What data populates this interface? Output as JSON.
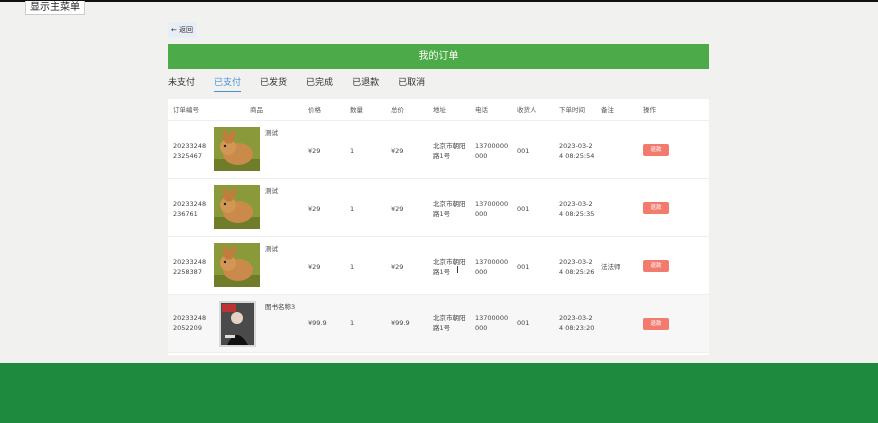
{
  "topbar": {
    "show_menu": "显示主菜单"
  },
  "back_label": "← 返回",
  "page_title": "我的订单",
  "tabs": [
    {
      "label": "未支付",
      "active": false
    },
    {
      "label": "已支付",
      "active": true
    },
    {
      "label": "已发货",
      "active": false
    },
    {
      "label": "已完成",
      "active": false
    },
    {
      "label": "已退款",
      "active": false
    },
    {
      "label": "已取消",
      "active": false
    }
  ],
  "columns": [
    "订单编号",
    "商品",
    "价格",
    "数量",
    "总价",
    "地址",
    "电话",
    "收货人",
    "下单时间",
    "备注",
    "操作"
  ],
  "orders": [
    {
      "id_line1": "20233248",
      "id_line2": "2325467",
      "product": "测试",
      "image": "rabbit",
      "price": "¥29",
      "qty": "1",
      "total": "¥29",
      "addr_line1": "北京市朝阳",
      "addr_line2": "路1号",
      "phone_line1": "13700000",
      "phone_line2": "000",
      "receiver": "001",
      "time_line1": "2023-03-2",
      "time_line2": "4 08:25:54",
      "remark": "",
      "action": "退款"
    },
    {
      "id_line1": "20233248",
      "id_line2": "236761",
      "product": "测试",
      "image": "rabbit",
      "price": "¥29",
      "qty": "1",
      "total": "¥29",
      "addr_line1": "北京市朝阳",
      "addr_line2": "路1号",
      "phone_line1": "13700000",
      "phone_line2": "000",
      "receiver": "001",
      "time_line1": "2023-03-2",
      "time_line2": "4 08:25:35",
      "remark": "",
      "action": "退款"
    },
    {
      "id_line1": "20233248",
      "id_line2": "2258387",
      "product": "测试",
      "image": "rabbit",
      "price": "¥29",
      "qty": "1",
      "total": "¥29",
      "addr_line1": "北京市朝阳",
      "addr_line2": "路1号",
      "phone_line1": "13700000",
      "phone_line2": "000",
      "receiver": "001",
      "time_line1": "2023-03-2",
      "time_line2": "4 08:25:26",
      "remark": "法法师",
      "action": "退款"
    },
    {
      "id_line1": "20233248",
      "id_line2": "2052209",
      "product": "图书名称3",
      "image": "book",
      "price": "¥99.9",
      "qty": "1",
      "total": "¥99.9",
      "addr_line1": "北京市朝阳",
      "addr_line2": "路1号",
      "phone_line1": "13700000",
      "phone_line2": "000",
      "receiver": "001",
      "time_line1": "2023-03-2",
      "time_line2": "4 08:23:20",
      "remark": "",
      "action": "退款"
    }
  ],
  "colors": {
    "green_header": "#4caa48",
    "footer_green": "#1e8a3e",
    "tab_active": "#4a90d9",
    "refund_button": "#f37b6d"
  }
}
